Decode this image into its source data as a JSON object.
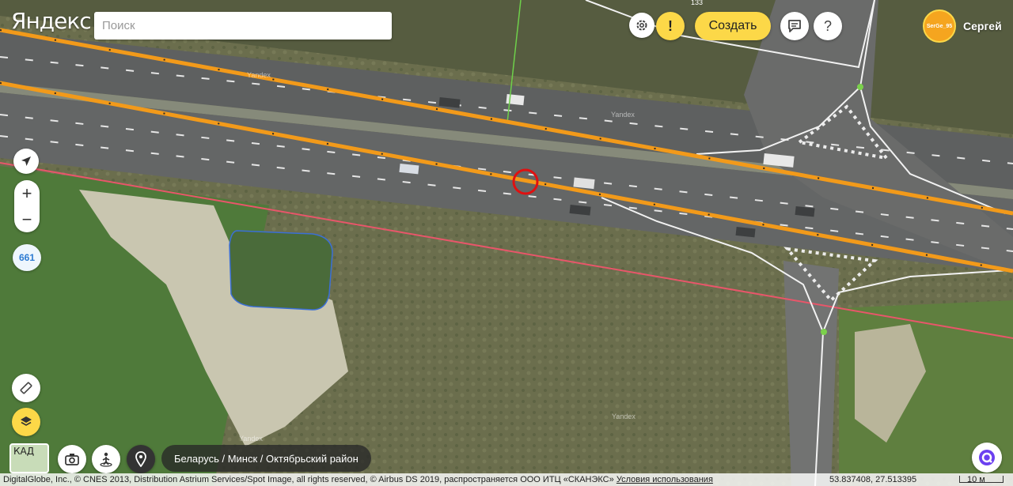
{
  "app": {
    "logo": "Яндекс"
  },
  "search": {
    "placeholder": "Поиск",
    "value": ""
  },
  "toolbar": {
    "settings_icon": "gear-icon",
    "alert_label": "!",
    "create_label": "Создать",
    "feedback_icon": "chat-icon",
    "help_label": "?"
  },
  "user": {
    "avatar_text": "SerGe_95",
    "name": "Сергей"
  },
  "controls": {
    "zoom_in": "+",
    "zoom_out": "−",
    "zoom_level": "661"
  },
  "breadcrumb": "Беларусь / Минск / Октябрьский район",
  "mini_map_label": "КАД",
  "footer": {
    "copyright": "DigitalGlobe, Inc., © CNES 2013, Distribution Astrium Services/Spot Image, all rights reserved, © Airbus DS 2019, распространяется ООО ИТЦ «СКАНЭКС»",
    "terms_link": "Условия использования",
    "coordinates": "53.837408, 27.513395",
    "scale": "10 м"
  },
  "map_labels": {
    "road_number": "133",
    "watermark": "Yandex"
  },
  "colors": {
    "road_edit": "#f29a1a",
    "selection": "#e01010",
    "boundary": "#e8566a",
    "polygon": "#3b6fd6",
    "accent": "#fcd848",
    "junction": "#7bd14b"
  }
}
